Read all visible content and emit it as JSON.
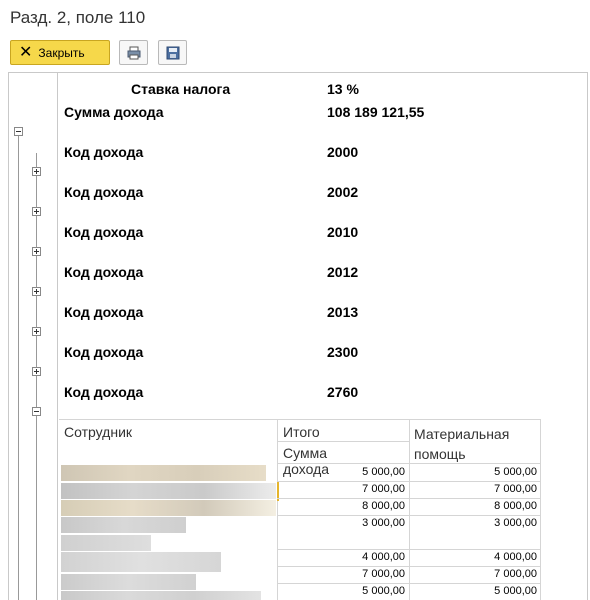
{
  "window": {
    "title": "Разд. 2, поле 110"
  },
  "toolbar": {
    "close_label": "Закрыть",
    "print_icon": "printer-icon",
    "save_icon": "save-icon"
  },
  "report": {
    "rate_label": "Ставка налога",
    "rate_value": "13 %",
    "sum_label": "Сумма дохода",
    "sum_value": "108 189 121,55",
    "code_label": "Код дохода",
    "codes": [
      "2000",
      "2002",
      "2010",
      "2012",
      "2013",
      "2300",
      "2760"
    ]
  },
  "table": {
    "col_employee": "Сотрудник",
    "col_total": "Итого",
    "col_total_sub": "Сумма дохода",
    "col_aid": "Материальная помощь",
    "rows": [
      {
        "total": "5 000,00",
        "aid": "5 000,00"
      },
      {
        "total": "7 000,00",
        "aid": "7 000,00"
      },
      {
        "total": "8 000,00",
        "aid": "8 000,00"
      },
      {
        "total": "3 000,00",
        "aid": "3 000,00"
      },
      {
        "total": "4 000,00",
        "aid": "4 000,00"
      },
      {
        "total": "7 000,00",
        "aid": "7 000,00"
      },
      {
        "total": "5 000,00",
        "aid": "5 000,00"
      }
    ]
  }
}
